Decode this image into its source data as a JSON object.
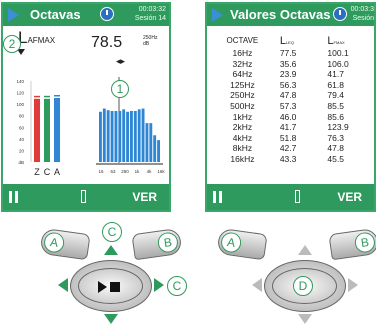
{
  "screen1": {
    "title": "Octavas",
    "time": "00:03:32",
    "session": "Sesión 14",
    "parameter": "L",
    "parameter_sub": "AFMAX",
    "value": "78.5",
    "value_unit": "250Hz",
    "value_unit2": "dB",
    "level_labels": [
      "140",
      "120",
      "100",
      "80",
      "60",
      "40",
      "20",
      "dB"
    ],
    "bar_letters": [
      "Z",
      "C",
      "A"
    ],
    "freq_labels": [
      "16",
      "63",
      "250",
      "1k",
      "4k",
      "16k"
    ],
    "callout_1": "1",
    "callout_2": "2",
    "footer_right": "VER",
    "level_bars": [
      0.78,
      0.78,
      0.79
    ],
    "spectrum": [
      0.62,
      0.66,
      0.64,
      0.63,
      0.63,
      0.63,
      0.65,
      0.62,
      0.63,
      0.63,
      0.65,
      0.66,
      0.48,
      0.48,
      0.33,
      0.27
    ],
    "colors": {
      "green": "#2f9a5e",
      "bar": "#2f86d4",
      "red": "#e03b3b"
    }
  },
  "screen2": {
    "title": "Valores Octavas",
    "time": "00:03:3",
    "session": "Sesión",
    "col_headers": [
      "OCTAVE",
      "L",
      "L"
    ],
    "col_subs": [
      "",
      "LEQ",
      "FMAX"
    ],
    "rows": [
      [
        "16Hz",
        "77.5",
        "100.1"
      ],
      [
        "32Hz",
        "35.6",
        "106.0"
      ],
      [
        "64Hz",
        "23.9",
        "41.7"
      ],
      [
        "125Hz",
        "56.3",
        "61.8"
      ],
      [
        "250Hz",
        "47.8",
        "79.4"
      ],
      [
        "500Hz",
        "57.3",
        "85.5"
      ],
      [
        "1kHz",
        "46.0",
        "85.6"
      ],
      [
        "2kHz",
        "41.7",
        "123.9"
      ],
      [
        "4kHz",
        "51.8",
        "76.3"
      ],
      [
        "8kHz",
        "42.7",
        "47.8"
      ],
      [
        "16kHz",
        "43.3",
        "45.5"
      ]
    ],
    "footer_right": "VER"
  },
  "keys": {
    "A": "A",
    "B": "B",
    "C": "C",
    "D": "D"
  }
}
